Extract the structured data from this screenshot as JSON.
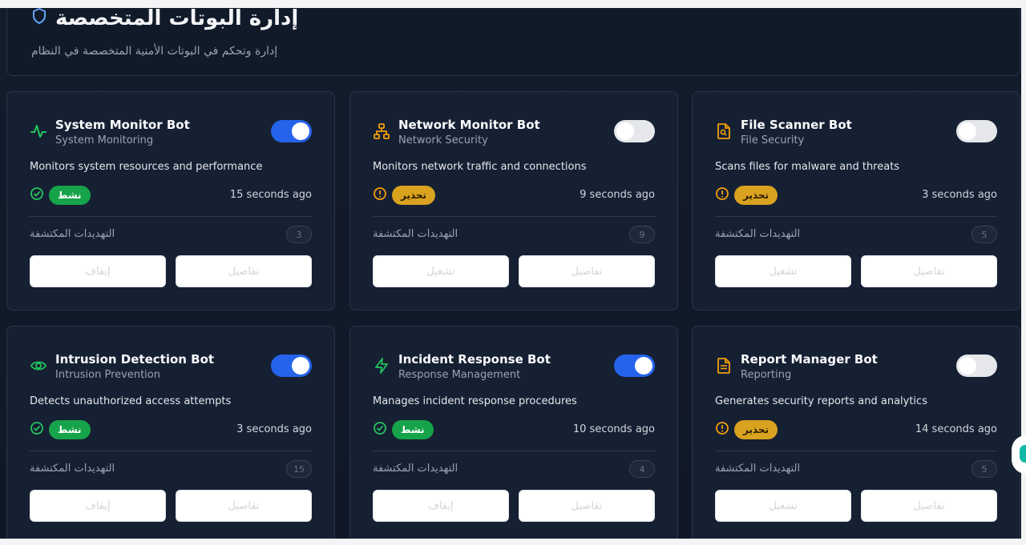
{
  "header": {
    "title": "إدارة البوتات المتخصصة",
    "subtitle": "إدارة وتحكم في البوتات الأمنية المتخصصة في النظام"
  },
  "labels": {
    "threats_detected": "التهديدات المكتشفة",
    "details": "تفاصيل"
  },
  "colors": {
    "active": "#16a34a",
    "warning": "#d9a21f",
    "toggle_on": "#2563eb"
  },
  "bots": [
    {
      "name": "System Monitor Bot",
      "category": "System Monitoring",
      "description": "Monitors system resources and performance",
      "status": "نشط",
      "status_type": "active",
      "time": "15 seconds ago",
      "threats": "3",
      "enabled": true,
      "action": "إيقاف",
      "icon": "activity-icon",
      "icon_color": "#22c55e"
    },
    {
      "name": "Network Monitor Bot",
      "category": "Network Security",
      "description": "Monitors network traffic and connections",
      "status": "تحذير",
      "status_type": "warning",
      "time": "9 seconds ago",
      "threats": "9",
      "enabled": false,
      "action": "تشغيل",
      "icon": "network-icon",
      "icon_color": "#f59e0b"
    },
    {
      "name": "File Scanner Bot",
      "category": "File Security",
      "description": "Scans files for malware and threats",
      "status": "تحذير",
      "status_type": "warning",
      "time": "3 seconds ago",
      "threats": "5",
      "enabled": false,
      "action": "تشغيل",
      "icon": "file-search-icon",
      "icon_color": "#f59e0b"
    },
    {
      "name": "Intrusion Detection Bot",
      "category": "Intrusion Prevention",
      "description": "Detects unauthorized access attempts",
      "status": "نشط",
      "status_type": "active",
      "time": "3 seconds ago",
      "threats": "15",
      "enabled": true,
      "action": "إيقاف",
      "icon": "eye-icon",
      "icon_color": "#22c55e"
    },
    {
      "name": "Incident Response Bot",
      "category": "Response Management",
      "description": "Manages incident response procedures",
      "status": "نشط",
      "status_type": "active",
      "time": "10 seconds ago",
      "threats": "4",
      "enabled": true,
      "action": "إيقاف",
      "icon": "zap-icon",
      "icon_color": "#22c55e"
    },
    {
      "name": "Report Manager Bot",
      "category": "Reporting",
      "description": "Generates security reports and analytics",
      "status": "تحذير",
      "status_type": "warning",
      "time": "14 seconds ago",
      "threats": "5",
      "enabled": false,
      "action": "تشغيل",
      "icon": "file-text-icon",
      "icon_color": "#f59e0b"
    }
  ]
}
